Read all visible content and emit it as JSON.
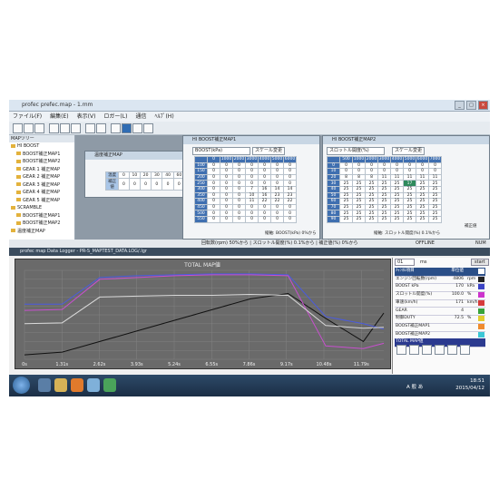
{
  "app": {
    "title": "profec prefec.map - 1.mm",
    "menu": [
      "ファイル(F)",
      "編集(E)",
      "表示(V)",
      "ロガー(L)",
      "通信",
      "ﾍﾙﾌﾟ(H)"
    ],
    "tree_header": "MAPツリー",
    "tree_items": [
      "HI BOOST",
      "BOOST補正MAP1",
      "BOOST補正MAP2",
      "GEAR 1 補正MAP",
      "GEAR 2 補正MAP",
      "GEAR 3 補正MAP",
      "GEAR 4 補正MAP",
      "GEAR 5 補正MAP",
      "SCRAMBLE",
      "BOOST補正MAP1",
      "BOOST補正MAP2",
      "温度補正MAP"
    ]
  },
  "temp_window": {
    "title": "温度補正MAP",
    "rows": [
      {
        "label": "温度",
        "cells": [
          "0",
          "10",
          "20",
          "30",
          "40",
          "60"
        ]
      },
      {
        "label": "補正値",
        "cells": [
          "0",
          "0",
          "0",
          "0",
          "0",
          "0"
        ]
      }
    ]
  },
  "map1": {
    "title": "HI BOOST補正MAP1",
    "axis_select": "BOOST(kPa)",
    "scale_button": "スケール変更",
    "footer": "縦軸: BOOST(kPa) 0%から",
    "header_row": [
      "",
      "0",
      "1000",
      "2000",
      "3000",
      "4000",
      "5000",
      "6000"
    ],
    "rows": [
      [
        "100",
        "0",
        "0",
        "0",
        "0",
        "0",
        "0",
        "0"
      ],
      [
        "150",
        "0",
        "0",
        "0",
        "0",
        "0",
        "0",
        "0"
      ],
      [
        "200",
        "0",
        "0",
        "0",
        "0",
        "0",
        "0",
        "0"
      ],
      [
        "250",
        "0",
        "0",
        "0",
        "0",
        "0",
        "0",
        "0"
      ],
      [
        "300",
        "0",
        "0",
        "0",
        "7",
        "16",
        "14",
        "14"
      ],
      [
        "350",
        "0",
        "0",
        "0",
        "10",
        "16",
        "23",
        "23"
      ],
      [
        "400",
        "0",
        "0",
        "0",
        "11",
        "22",
        "22",
        "22"
      ],
      [
        "450",
        "0",
        "0",
        "0",
        "0",
        "0",
        "0",
        "0"
      ],
      [
        "500",
        "0",
        "0",
        "0",
        "0",
        "0",
        "0",
        "0"
      ],
      [
        "550",
        "0",
        "0",
        "0",
        "0",
        "0",
        "0",
        "0"
      ]
    ]
  },
  "map2": {
    "title": "HI BOOST補正MAP2",
    "axis_select": "スロットル開度(%)",
    "scale_button": "スケール変更",
    "footer": "縦軸: スロットル開度(%) 0.1%から",
    "footer2": "補正値",
    "header_row": [
      "",
      "500",
      "1000",
      "2000",
      "3000",
      "4000",
      "5000",
      "6000",
      "7000"
    ],
    "rows": [
      [
        "0",
        "0",
        "0",
        "0",
        "0",
        "0",
        "0",
        "0",
        "0"
      ],
      [
        "10",
        "0",
        "0",
        "0",
        "0",
        "0",
        "0",
        "0",
        "0"
      ],
      [
        "20",
        "8",
        "8",
        "8",
        "11",
        "11",
        "11",
        "11",
        "11"
      ],
      [
        "30",
        "25",
        "25",
        "25",
        "25",
        "25",
        "17",
        "25",
        "25"
      ],
      [
        "40",
        "25",
        "25",
        "25",
        "25",
        "25",
        "25",
        "25",
        "25"
      ],
      [
        "50",
        "25",
        "25",
        "25",
        "25",
        "25",
        "25",
        "25",
        "25"
      ],
      [
        "60",
        "25",
        "25",
        "25",
        "25",
        "25",
        "25",
        "25",
        "25"
      ],
      [
        "70",
        "25",
        "25",
        "25",
        "25",
        "25",
        "25",
        "25",
        "25"
      ],
      [
        "80",
        "25",
        "25",
        "25",
        "25",
        "25",
        "25",
        "25",
        "25"
      ],
      [
        "90",
        "25",
        "25",
        "25",
        "25",
        "25",
        "25",
        "25",
        "25"
      ]
    ]
  },
  "status": {
    "left": "回転数(rpm) 50%から | スロットル開度(%) 0.1%から | 補正値(%) 0%から",
    "right": "OFFLINE",
    "num": "NUM"
  },
  "logger": {
    "title": "profec map Data Logger - PR-S_MAPTEST_DATA.LOG/.lgr",
    "chart_title": "TOTAL MAP値",
    "time_ticks": [
      "0s",
      "1.31s",
      "2.62s",
      "3.93s",
      "5.24s",
      "6.55s",
      "7.86s",
      "9.17s",
      "10.48s",
      "11.79s"
    ],
    "controls": {
      "select": "01",
      "unit": "ms",
      "button": "start"
    },
    "channels": [
      {
        "name": "ﾁｬﾝﾈﾙ項目",
        "value": "単位値",
        "unit": "",
        "color": "#ffffff"
      },
      {
        "name": "エンジン回転数(rpm)",
        "value": "4806",
        "unit": "rpm",
        "color": "#222222"
      },
      {
        "name": "BOOST kPa",
        "value": "170",
        "unit": "kPa",
        "color": "#3b43c4"
      },
      {
        "name": "スロットル開度(%)",
        "value": "100.0",
        "unit": "%",
        "color": "#cc33cc"
      },
      {
        "name": "車速(km/h)",
        "value": "171",
        "unit": "km/h",
        "color": "#d63a3a"
      },
      {
        "name": "GEAR",
        "value": "4",
        "unit": "",
        "color": "#37a33a"
      },
      {
        "name": "制御DUTY",
        "value": "72.5",
        "unit": "%",
        "color": "#e2cc2e"
      },
      {
        "name": "BOOST補正MAP1",
        "value": "",
        "unit": "",
        "color": "#f08b2d"
      },
      {
        "name": "BOOST補正MAP2",
        "value": "",
        "unit": "",
        "color": "#3cc7d6"
      },
      {
        "name": "TOTAL MAP値",
        "value": "",
        "unit": "",
        "color": "#2b3a8f"
      }
    ]
  },
  "chart_data": {
    "type": "line",
    "title": "TOTAL MAP値",
    "x": [
      0,
      1.31,
      2.62,
      3.93,
      5.24,
      6.55,
      7.86,
      9.17,
      10.48,
      11.79,
      12.5
    ],
    "series": [
      {
        "name": "エンジン回転数(rpm)",
        "color": "#111111",
        "values": [
          5,
          8,
          20,
          32,
          44,
          56,
          68,
          74,
          46,
          20,
          52
        ]
      },
      {
        "name": "BOOST kPa",
        "color": "#4a5be0",
        "values": [
          62,
          62,
          92,
          94,
          95,
          96,
          96,
          95,
          48,
          40,
          34
        ]
      },
      {
        "name": "スロットル開度(%)",
        "color": "#c94fd0",
        "values": [
          55,
          56,
          90,
          92,
          94,
          95,
          95,
          94,
          15,
          12,
          18
        ]
      },
      {
        "name": "TOTAL MAP値",
        "color": "#d9d9d9",
        "values": [
          40,
          41,
          70,
          71,
          72,
          72,
          73,
          72,
          38,
          35,
          36
        ]
      }
    ],
    "ylim": [
      0,
      100
    ]
  },
  "taskbar": {
    "time": "18:51",
    "date": "2015/04/12",
    "lang": "A 般 あ"
  }
}
